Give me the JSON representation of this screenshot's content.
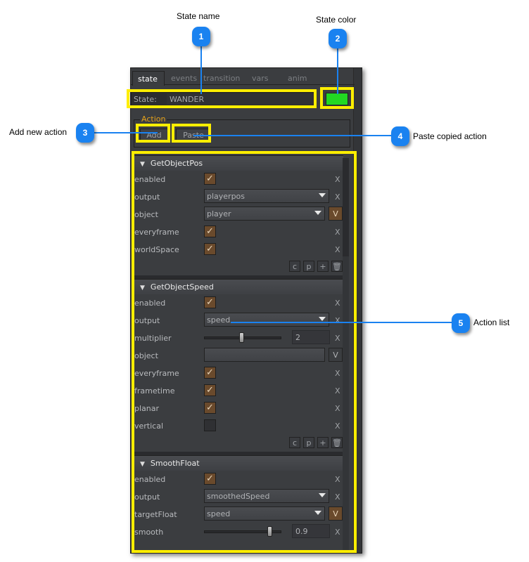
{
  "callouts": [
    {
      "number": "1",
      "label": "State name"
    },
    {
      "number": "2",
      "label": "State color"
    },
    {
      "number": "3",
      "label": "Add new action"
    },
    {
      "number": "4",
      "label": "Paste copied action"
    },
    {
      "number": "5",
      "label": "Action list"
    }
  ],
  "tabs": [
    "state",
    "events",
    "transition",
    "vars",
    "anim"
  ],
  "state": {
    "label": "State:",
    "value": "WANDER",
    "color": "#22d822"
  },
  "action_group": {
    "legend": "Action",
    "add_label": "Add",
    "paste_label": "Paste"
  },
  "glyphs": {
    "collapse": "▼",
    "check": "✓",
    "remove": "X",
    "variable": "V",
    "copy": "c",
    "paste": "p",
    "add": "+",
    "delete": "🗑"
  },
  "actions": [
    {
      "name": "GetObjectPos",
      "props": [
        {
          "label": "enabled",
          "type": "checkbox",
          "checked": true
        },
        {
          "label": "output",
          "type": "dropdown",
          "value": "playerpos"
        },
        {
          "label": "object",
          "type": "dropdown-var",
          "value": "player"
        },
        {
          "label": "everyframe",
          "type": "checkbox",
          "checked": true
        },
        {
          "label": "worldSpace",
          "type": "checkbox",
          "checked": true
        }
      ]
    },
    {
      "name": "GetObjectSpeed",
      "props": [
        {
          "label": "enabled",
          "type": "checkbox",
          "checked": true
        },
        {
          "label": "output",
          "type": "dropdown",
          "value": "speed"
        },
        {
          "label": "multiplier",
          "type": "slider",
          "value": "2",
          "fraction": 0.5
        },
        {
          "label": "object",
          "type": "field-var",
          "value": ""
        },
        {
          "label": "everyframe",
          "type": "checkbox",
          "checked": true
        },
        {
          "label": "frametime",
          "type": "checkbox",
          "checked": true
        },
        {
          "label": "planar",
          "type": "checkbox",
          "checked": true
        },
        {
          "label": "vertical",
          "type": "checkbox",
          "checked": false
        }
      ]
    },
    {
      "name": "SmoothFloat",
      "props": [
        {
          "label": "enabled",
          "type": "checkbox",
          "checked": true
        },
        {
          "label": "output",
          "type": "dropdown",
          "value": "smoothedSpeed"
        },
        {
          "label": "targetFloat",
          "type": "dropdown-var",
          "value": "speed"
        },
        {
          "label": "smooth",
          "type": "slider",
          "value": "0.9",
          "fraction": 0.9
        }
      ]
    }
  ]
}
